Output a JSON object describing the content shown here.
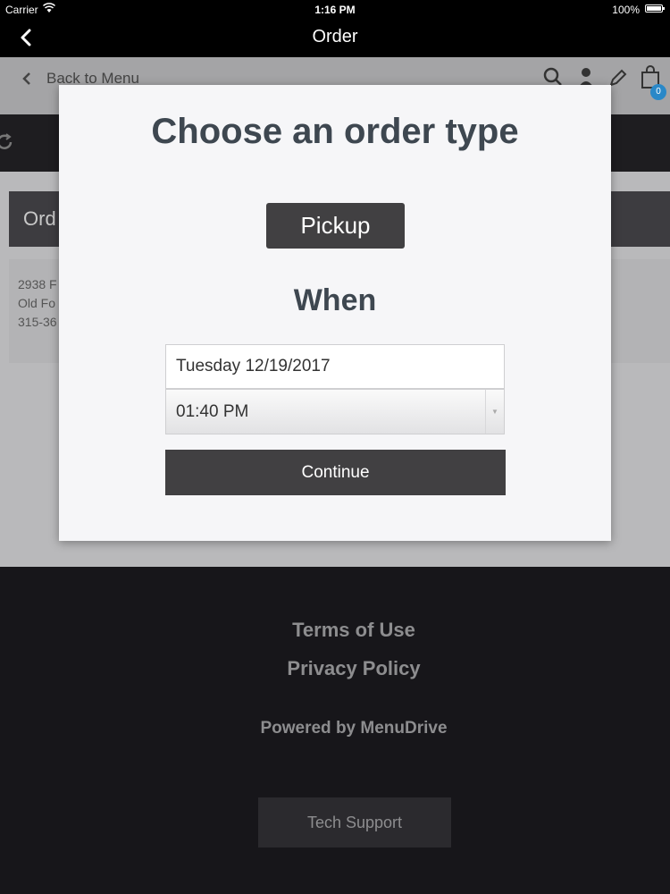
{
  "status_bar": {
    "carrier": "Carrier",
    "time": "1:16 PM",
    "battery": "100%"
  },
  "nav_bar": {
    "title": "Order"
  },
  "background_page": {
    "back_to_menu": "Back to Menu",
    "cart_count": "0",
    "order_header_partial": "Ord",
    "address_lines": [
      "2938 F",
      "Old Fo",
      "315-36"
    ]
  },
  "modal": {
    "heading": "Choose an order type",
    "order_type_button": "Pickup",
    "when_label": "When",
    "date_value": "Tuesday 12/19/2017",
    "time_value": "01:40 PM",
    "continue_label": "Continue"
  },
  "footer": {
    "terms": "Terms of Use",
    "privacy": "Privacy Policy",
    "powered_by": "Powered by MenuDrive",
    "tech_support": "Tech Support"
  },
  "colors": {
    "accent_dark": "#414042",
    "badge_blue": "#2a88c8",
    "heading_text": "#3e4750"
  }
}
